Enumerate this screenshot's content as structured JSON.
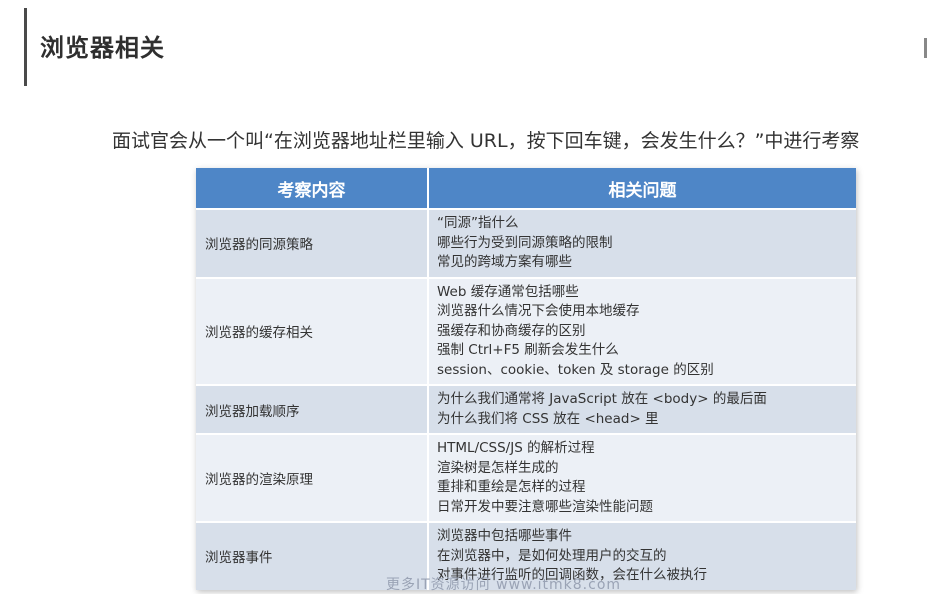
{
  "page": {
    "title": "浏览器相关",
    "intro": "面试官会从一个叫“在浏览器地址栏里输入 URL，按下回车键，会发生什么？”中进行考察"
  },
  "table": {
    "headers": [
      "考察内容",
      "相关问题"
    ],
    "rows": [
      {
        "topic": "浏览器的同源策略",
        "questions": [
          "“同源”指什么",
          "哪些行为受到同源策略的限制",
          "常见的跨域方案有哪些"
        ]
      },
      {
        "topic": "浏览器的缓存相关",
        "questions": [
          "Web 缓存通常包括哪些",
          "浏览器什么情况下会使用本地缓存",
          "强缓存和协商缓存的区别",
          "强制 Ctrl+F5 刷新会发生什么",
          "session、cookie、token 及 storage 的区别"
        ]
      },
      {
        "topic": "浏览器加载顺序",
        "questions": [
          "为什么我们通常将 JavaScript 放在 <body> 的最后面",
          "为什么我们将 CSS 放在 <head> 里"
        ]
      },
      {
        "topic": "浏览器的渲染原理",
        "questions": [
          "HTML/CSS/JS 的解析过程",
          "渲染树是怎样生成的",
          "重排和重绘是怎样的过程",
          "日常开发中要注意哪些渲染性能问题"
        ]
      },
      {
        "topic": "浏览器事件",
        "questions": [
          "浏览器中包括哪些事件",
          "在浏览器中，是如何处理用户的交互的",
          "对事件进行监听的回调函数，会在什么被执行"
        ]
      }
    ]
  },
  "watermark": "更多IT资源访问  www.itmk8.com",
  "colors": {
    "header_bg": "#4e86c7",
    "row_odd": "#d7dfea",
    "row_even": "#ecf0f6"
  }
}
